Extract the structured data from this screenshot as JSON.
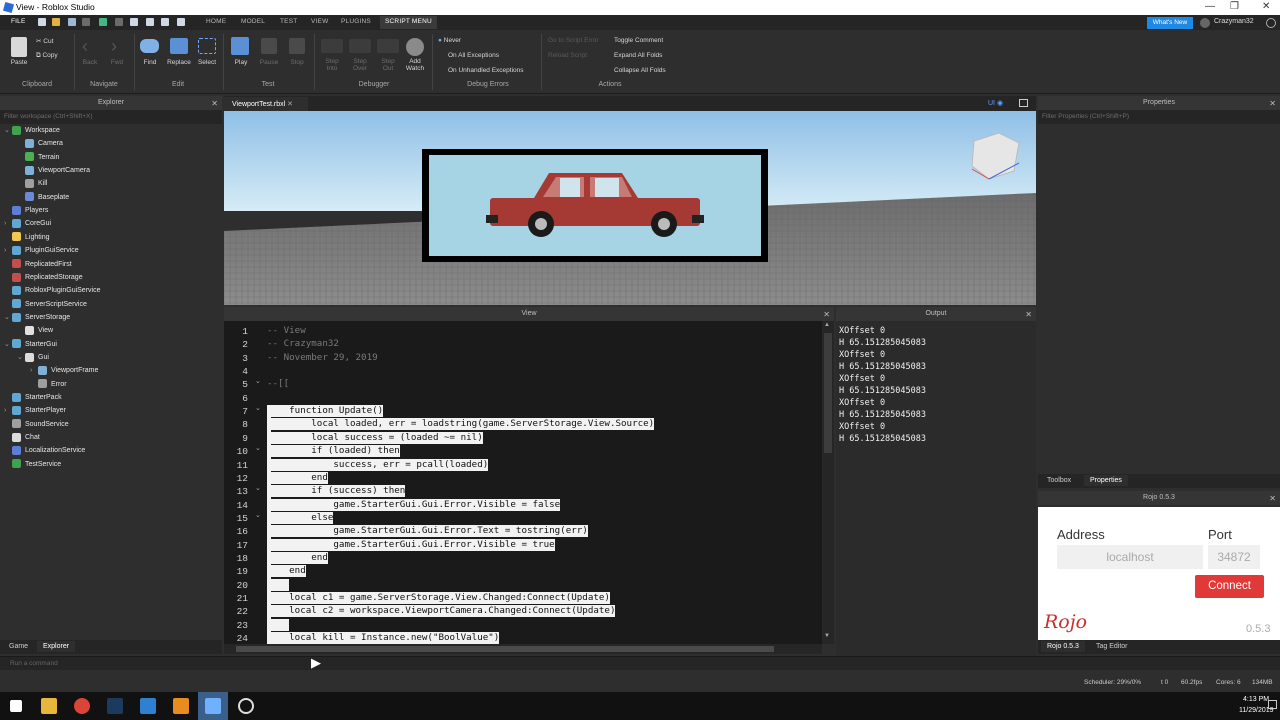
{
  "window": {
    "title": "View - Roblox Studio"
  },
  "menu": {
    "file": "FILE",
    "tabs": [
      "HOME",
      "MODEL",
      "TEST",
      "VIEW",
      "PLUGINS",
      "SCRIPT MENU"
    ],
    "whats_new": "What's New",
    "user": "Crazyman32"
  },
  "ribbon": {
    "paste": "Paste",
    "cut": "Cut",
    "copy": "Copy",
    "back": "Back",
    "fwd": "Fwd",
    "find": "Find",
    "replace": "Replace",
    "select": "Select",
    "play": "Play",
    "pause": "Pause",
    "stop": "Stop",
    "step_into": "Step\nInto",
    "step_over": "Step\nOver",
    "step_out": "Step\nOut",
    "add_watch": "Add\nWatch",
    "never": "Never",
    "on_all": "On All Exceptions",
    "on_unhandled": "On Unhandled Exceptions",
    "goto_error": "Go to Script Error",
    "reload": "Reload Script",
    "toggle_comment": "Toggle Comment",
    "expand_all": "Expand All Folds",
    "collapse_all": "Collapse All Folds",
    "groups": {
      "clipboard": "Clipboard",
      "navigate": "Navigate",
      "edit": "Edit",
      "test": "Test",
      "debugger": "Debugger",
      "debug_errors": "Debug Errors",
      "actions": "Actions"
    }
  },
  "explorer": {
    "title": "Explorer",
    "filter": "Filter workspace (Ctrl+Shift+X)",
    "items": [
      {
        "label": "Workspace",
        "depth": 0,
        "arrow": "⌄",
        "color": "#3fa34d"
      },
      {
        "label": "Camera",
        "depth": 1,
        "arrow": "",
        "color": "#7fb0d8"
      },
      {
        "label": "Terrain",
        "depth": 1,
        "arrow": "",
        "color": "#4caf50"
      },
      {
        "label": "ViewportCamera",
        "depth": 1,
        "arrow": "",
        "color": "#7fb0d8"
      },
      {
        "label": "Kill",
        "depth": 1,
        "arrow": "",
        "color": "#a0a0a0"
      },
      {
        "label": "Baseplate",
        "depth": 1,
        "arrow": "",
        "color": "#6b8bd6"
      },
      {
        "label": "Players",
        "depth": 0,
        "arrow": "",
        "color": "#5b7fd6"
      },
      {
        "label": "CoreGui",
        "depth": 0,
        "arrow": "›",
        "color": "#5fa8d3"
      },
      {
        "label": "Lighting",
        "depth": 0,
        "arrow": "",
        "color": "#f2c94c"
      },
      {
        "label": "PluginGuiService",
        "depth": 0,
        "arrow": "›",
        "color": "#5fa8d3"
      },
      {
        "label": "ReplicatedFirst",
        "depth": 0,
        "arrow": "",
        "color": "#c0504d"
      },
      {
        "label": "ReplicatedStorage",
        "depth": 0,
        "arrow": "",
        "color": "#c0504d"
      },
      {
        "label": "RobloxPluginGuiService",
        "depth": 0,
        "arrow": "",
        "color": "#5fa8d3"
      },
      {
        "label": "ServerScriptService",
        "depth": 0,
        "arrow": "",
        "color": "#5fa8d3"
      },
      {
        "label": "ServerStorage",
        "depth": 0,
        "arrow": "⌄",
        "color": "#5fa8d3"
      },
      {
        "label": "View",
        "depth": 1,
        "arrow": "",
        "color": "#e0e0e0"
      },
      {
        "label": "StarterGui",
        "depth": 0,
        "arrow": "⌄",
        "color": "#5fa8d3"
      },
      {
        "label": "Gui",
        "depth": 1,
        "arrow": "⌄",
        "color": "#dcdcdc"
      },
      {
        "label": "ViewportFrame",
        "depth": 2,
        "arrow": "›",
        "color": "#7fb0d8"
      },
      {
        "label": "Error",
        "depth": 2,
        "arrow": "",
        "color": "#9e9e9e"
      },
      {
        "label": "StarterPack",
        "depth": 0,
        "arrow": "",
        "color": "#5fa8d3"
      },
      {
        "label": "StarterPlayer",
        "depth": 0,
        "arrow": "›",
        "color": "#5fa8d3"
      },
      {
        "label": "SoundService",
        "depth": 0,
        "arrow": "",
        "color": "#a0a0a0"
      },
      {
        "label": "Chat",
        "depth": 0,
        "arrow": "",
        "color": "#dcdcdc"
      },
      {
        "label": "LocalizationService",
        "depth": 0,
        "arrow": "",
        "color": "#5b7fd6"
      },
      {
        "label": "TestService",
        "depth": 0,
        "arrow": "",
        "color": "#3fa34d"
      }
    ],
    "bottom_tabs": [
      "Game",
      "Explorer"
    ]
  },
  "viewport": {
    "tab": "ViewportTest.rbxl",
    "ui_label": "UI"
  },
  "script": {
    "title": "View",
    "lines": [
      {
        "n": "1",
        "t": "-- View",
        "c": true,
        "s": false
      },
      {
        "n": "2",
        "t": "-- Crazyman32",
        "c": true,
        "s": false
      },
      {
        "n": "3",
        "t": "-- November 29, 2019",
        "c": true,
        "s": false
      },
      {
        "n": "4",
        "t": "",
        "c": false,
        "s": false
      },
      {
        "n": "5",
        "t": "--[[",
        "c": true,
        "s": false
      },
      {
        "n": "6",
        "t": "",
        "c": false,
        "s": false
      },
      {
        "n": "7",
        "t": "    function Update()",
        "c": false,
        "s": true
      },
      {
        "n": "8",
        "t": "        local loaded, err = loadstring(game.ServerStorage.View.Source)",
        "c": false,
        "s": true
      },
      {
        "n": "9",
        "t": "        local success = (loaded ~= nil)",
        "c": false,
        "s": true
      },
      {
        "n": "10",
        "t": "        if (loaded) then",
        "c": false,
        "s": true
      },
      {
        "n": "11",
        "t": "            success, err = pcall(loaded)",
        "c": false,
        "s": true
      },
      {
        "n": "12",
        "t": "        end",
        "c": false,
        "s": true
      },
      {
        "n": "13",
        "t": "        if (success) then",
        "c": false,
        "s": true
      },
      {
        "n": "14",
        "t": "            game.StarterGui.Gui.Error.Visible = false",
        "c": false,
        "s": true
      },
      {
        "n": "15",
        "t": "        else",
        "c": false,
        "s": true
      },
      {
        "n": "16",
        "t": "            game.StarterGui.Gui.Error.Text = tostring(err)",
        "c": false,
        "s": true
      },
      {
        "n": "17",
        "t": "            game.StarterGui.Gui.Error.Visible = true",
        "c": false,
        "s": true
      },
      {
        "n": "18",
        "t": "        end",
        "c": false,
        "s": true
      },
      {
        "n": "19",
        "t": "    end",
        "c": false,
        "s": true
      },
      {
        "n": "20",
        "t": "    ",
        "c": false,
        "s": true
      },
      {
        "n": "21",
        "t": "    local c1 = game.ServerStorage.View.Changed:Connect(Update)",
        "c": false,
        "s": true
      },
      {
        "n": "22",
        "t": "    local c2 = workspace.ViewportCamera.Changed:Connect(Update)",
        "c": false,
        "s": true
      },
      {
        "n": "23",
        "t": "    ",
        "c": false,
        "s": true
      },
      {
        "n": "24",
        "t": "    local kill = Instance.new(\"BoolValue\")",
        "c": false,
        "s": true
      }
    ]
  },
  "output": {
    "title": "Output",
    "lines": [
      "XOffset 0",
      "H 65.151285045083",
      "XOffset 0",
      "H 65.151285045083",
      "XOffset 0",
      "H 65.151285045083",
      "XOffset 0",
      "H 65.151285045083",
      "XOffset 0",
      "H 65.151285045083"
    ]
  },
  "properties": {
    "title": "Properties",
    "filter": "Filter Properties (Ctrl+Shift+P)",
    "tabs": [
      "Toolbox",
      "Properties"
    ]
  },
  "rojo": {
    "title": "Rojo 0.5.3",
    "address_label": "Address",
    "port_label": "Port",
    "address_placeholder": "localhost",
    "port_placeholder": "34872",
    "connect": "Connect",
    "logo": "Rojo",
    "version": "0.5.3",
    "tabs": [
      "Rojo 0.5.3",
      "Tag Editor"
    ]
  },
  "command": {
    "placeholder": "Run a command"
  },
  "status": {
    "scheduler": "Scheduler: 29%/0%",
    "t": "t 0",
    "fps": "60.2fps",
    "cores": "Cores: 6",
    "mem": "134MB"
  },
  "taskbar": {
    "time": "4:13 PM",
    "date": "11/29/2019"
  }
}
